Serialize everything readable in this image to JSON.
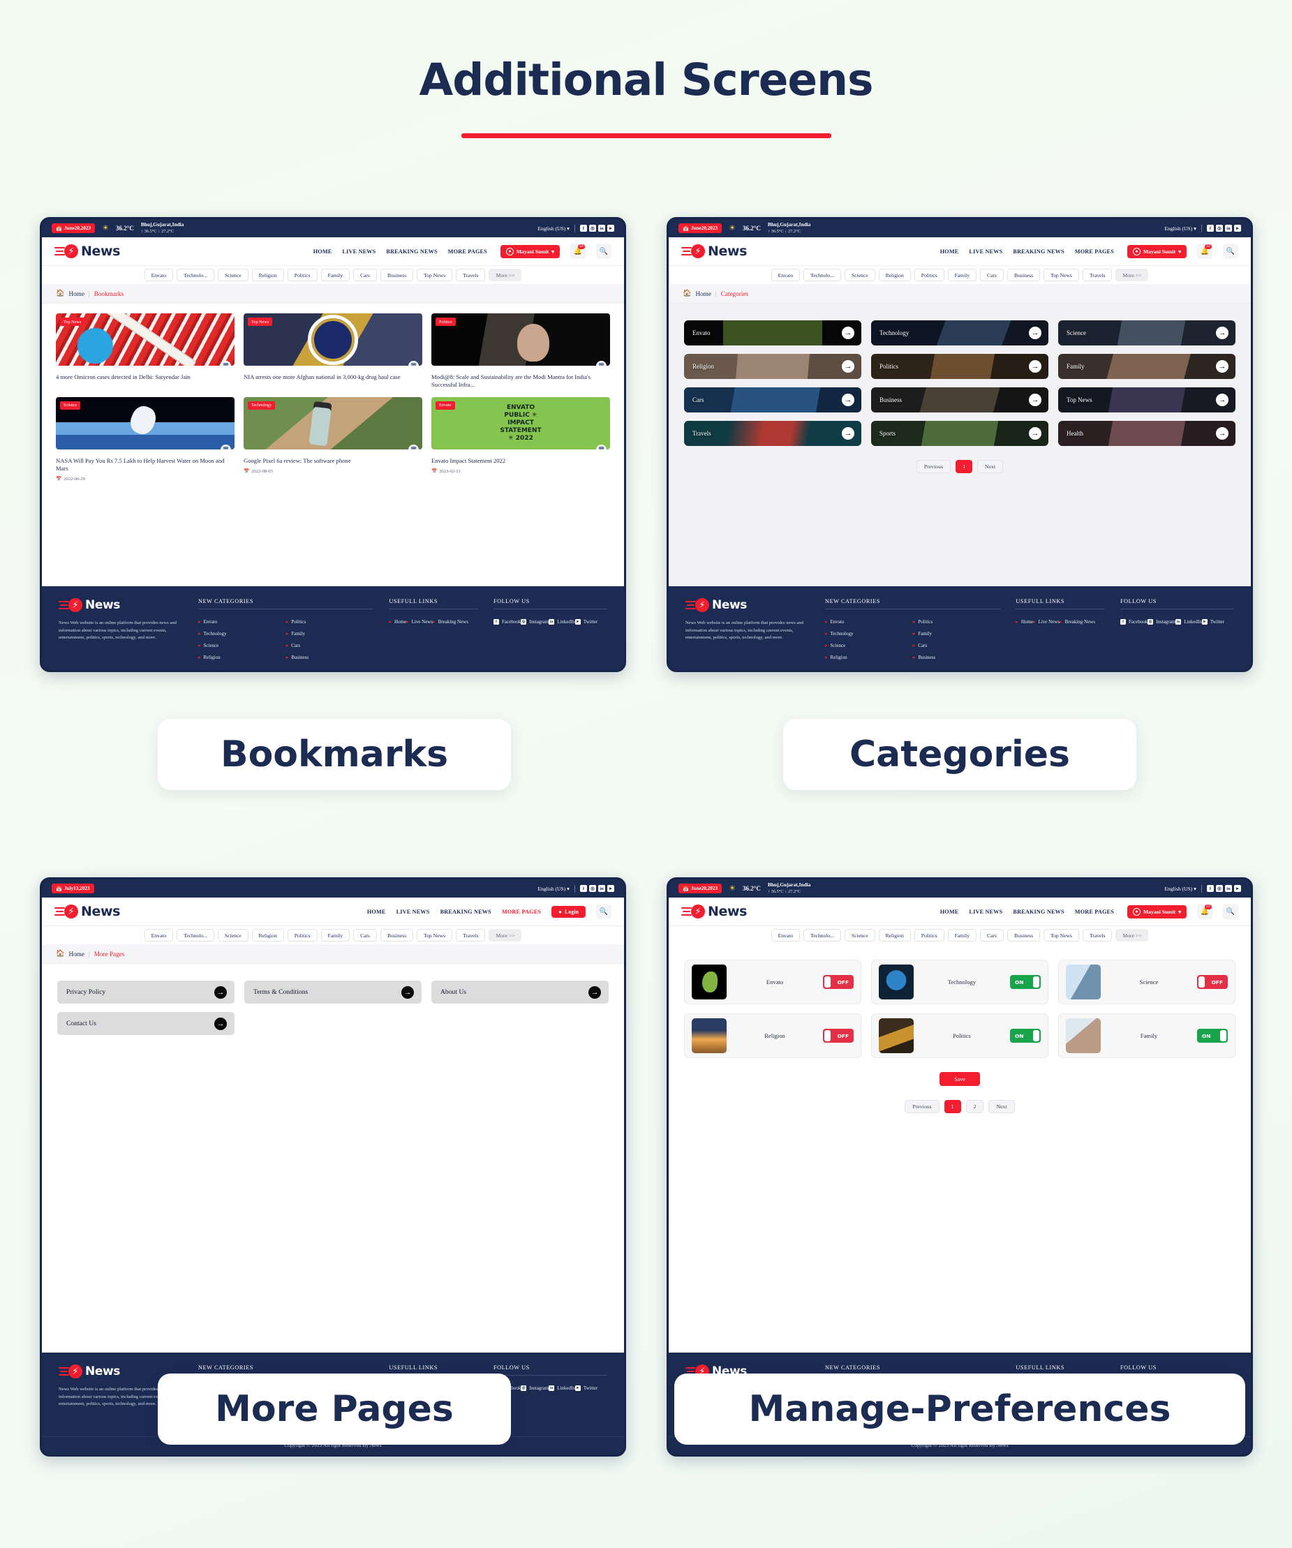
{
  "page": {
    "title": "Additional Screens"
  },
  "common": {
    "topbar": {
      "date": "June20,2023",
      "date_alt": "July13,2023",
      "temp": "36.2°C",
      "location": "Bhuj,Gujarat,India",
      "temp_range": "↑ 36.5°C  ↓ 27.2°C",
      "language": "English (US)",
      "socials": [
        "f",
        "@",
        "in",
        "t"
      ]
    },
    "brand": {
      "name": "News",
      "bolt": "⚡"
    },
    "nav": [
      "HOME",
      "LIVE NEWS",
      "BREAKING NEWS",
      "MORE PAGES"
    ],
    "user": "Mayani Sumit",
    "login": "Login",
    "notification_count": "10",
    "chips": [
      "Envato",
      "Technolo...",
      "Science",
      "Religion",
      "Politics",
      "Family",
      "Cars",
      "Business",
      "Top News",
      "Travels"
    ],
    "chip_more": "More >>",
    "footer": {
      "description": "News Web website is an online platform that provides news and information about various topics, including current events, entertainment, politics, sports, technology, and more.",
      "col1_head": "NEW CATEGORIES",
      "col2_head": "USEFULL LINKS",
      "col3_head": "FOLLOW US",
      "categories": [
        "Envato",
        "Politics",
        "Technology",
        "Family",
        "Science",
        "Cars",
        "Religion",
        "Business"
      ],
      "links": [
        "Home",
        "Live News",
        "Breaking News"
      ],
      "socials": [
        {
          "icon": "f",
          "label": "Facebook"
        },
        {
          "icon": "@",
          "label": "Instagram"
        },
        {
          "icon": "in",
          "label": "LinkedIn"
        },
        {
          "icon": "t",
          "label": "Twitter"
        }
      ],
      "copyright": "Copyright © 2023 All right Reserved By News"
    }
  },
  "screens": [
    {
      "id": "bookmarks",
      "caption": "Bookmarks",
      "breadcrumb": {
        "home": "Home",
        "current": "Bookmarks"
      },
      "cards": [
        {
          "tag": "Top News",
          "title": "4 more Omicron cases detected in Delhi: Satyendar Jain",
          "date": "",
          "art": "ph-covid"
        },
        {
          "tag": "Top News",
          "title": "NIA arrests one more Afghan national in 3,000-kg drug haul case",
          "date": "",
          "art": "ph-nia"
        },
        {
          "tag": "Politics",
          "title": "Modi@8: Scale and Sustainability are the Modi Mantra for India's Successful Infra...",
          "date": "",
          "art": "ph-modi"
        },
        {
          "tag": "Science",
          "title": "NASA Will Pay You Rs 7.5 Lakh to Help Harvest Water on Moon and Mars",
          "date": "2022-06-20",
          "art": "ph-space"
        },
        {
          "tag": "Technology",
          "title": "Google Pixel 6a review: The software phone",
          "date": "2022-08-05",
          "art": "ph-pixel"
        },
        {
          "tag": "Envato",
          "title": "Envato Impact Statement 2022",
          "date": "2023-02-21",
          "art": "ph-envato"
        }
      ],
      "envato_art_lines": [
        "ENVATO",
        "PUBLIC ✳",
        "IMPACT",
        "STATEMENT",
        "✳ 2022"
      ]
    },
    {
      "id": "categories",
      "caption": "Categories",
      "breadcrumb": {
        "home": "Home",
        "current": "Categories"
      },
      "tiles": [
        {
          "label": "Envato",
          "bg": "bgE"
        },
        {
          "label": "Technology",
          "bg": "bgT"
        },
        {
          "label": "Science",
          "bg": "bgS"
        },
        {
          "label": "Religion",
          "bg": "bgR"
        },
        {
          "label": "Politics",
          "bg": "bgP"
        },
        {
          "label": "Family",
          "bg": "bgF"
        },
        {
          "label": "Cars",
          "bg": "bgC"
        },
        {
          "label": "Business",
          "bg": "bgB"
        },
        {
          "label": "Top News",
          "bg": "bgN"
        },
        {
          "label": "Travels",
          "bg": "bgV"
        },
        {
          "label": "Sports",
          "bg": "bgSp"
        },
        {
          "label": "Health",
          "bg": "bgH"
        }
      ],
      "pagination": {
        "previous": "Previous",
        "pages": [
          "1"
        ],
        "next": "Next",
        "current": "1"
      }
    },
    {
      "id": "more-pages",
      "caption": "More Pages",
      "breadcrumb": {
        "home": "Home",
        "current": "More Pages"
      },
      "tiles": [
        "Privacy Policy",
        "Terms & Conditions",
        "About Us",
        "Contact Us"
      ]
    },
    {
      "id": "manage-preferences",
      "caption": "Manage-Preferences",
      "prefs": [
        {
          "name": "Envato",
          "state": "OFF",
          "thumb": "th-envato"
        },
        {
          "name": "Technology",
          "state": "ON",
          "thumb": "th-tech"
        },
        {
          "name": "Science",
          "state": "OFF",
          "thumb": "th-sci"
        },
        {
          "name": "Religion",
          "state": "OFF",
          "thumb": "th-rel"
        },
        {
          "name": "Politics",
          "state": "ON",
          "thumb": "th-pol"
        },
        {
          "name": "Family",
          "state": "ON",
          "thumb": "th-fam"
        }
      ],
      "save_label": "Save",
      "pagination": {
        "previous": "Previous",
        "pages": [
          "1",
          "2"
        ],
        "next": "Next",
        "current": "1"
      }
    }
  ]
}
